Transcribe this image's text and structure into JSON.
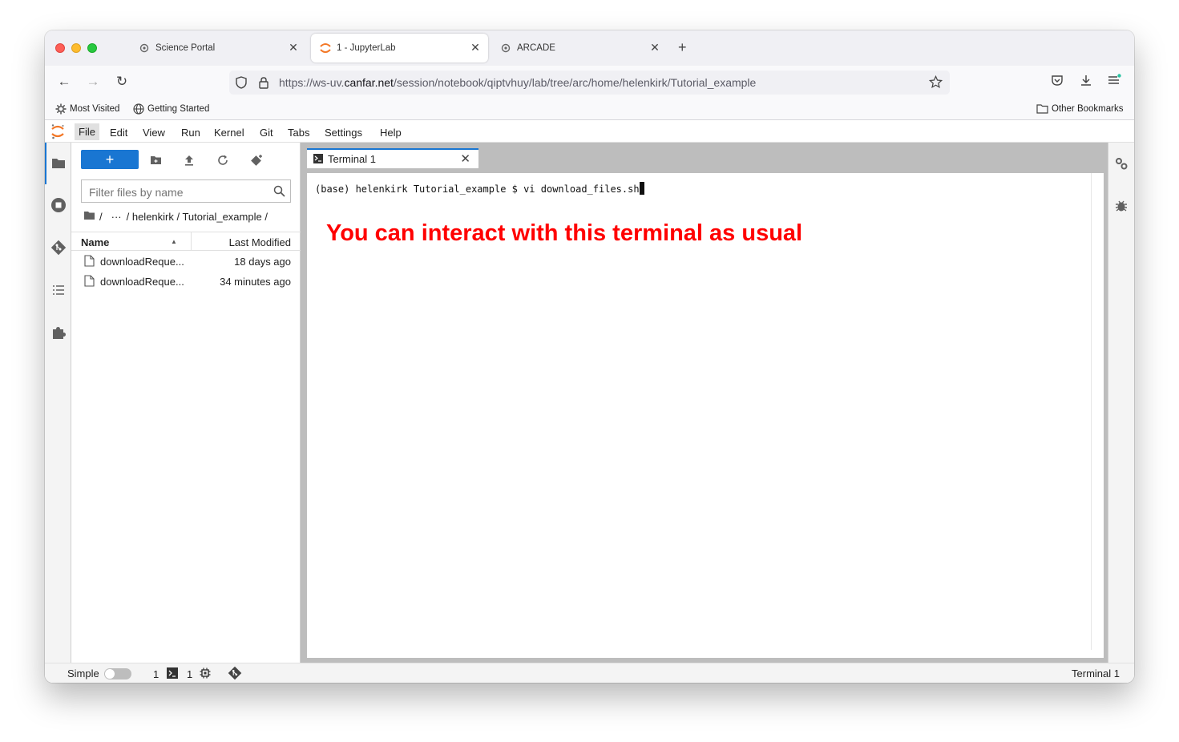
{
  "browser": {
    "tabs": [
      {
        "title": "Science Portal",
        "icon": "puzzle-gear-icon",
        "active": false
      },
      {
        "title": "1 - JupyterLab",
        "icon": "jupyter-logo-icon",
        "active": true
      },
      {
        "title": "ARCADE",
        "icon": "puzzle-gear-icon",
        "active": false
      }
    ],
    "new_tab": "+",
    "url_host_prefix": "https://ws-uv.",
    "url_host_domain": "canfar.net",
    "url_path": "/session/notebook/qiptvhuy/lab/tree/arc/home/helenkirk/Tutorial_example",
    "bookmarks": [
      {
        "label": "Most Visited",
        "icon": "gear-icon"
      },
      {
        "label": "Getting Started",
        "icon": "globe-icon"
      }
    ],
    "other_bookmarks": "Other Bookmarks"
  },
  "jupyter": {
    "menus": [
      "File",
      "Edit",
      "View",
      "Run",
      "Kernel",
      "Git",
      "Tabs",
      "Settings",
      "Help"
    ],
    "new_button": "+",
    "filter_placeholder": "Filter files by name",
    "breadcrumb": {
      "root": "/",
      "ellipsis": "···",
      "path": "/ helenkirk / Tutorial_example /"
    },
    "columns": {
      "name": "Name",
      "modified": "Last Modified"
    },
    "files": [
      {
        "name": "downloadReque...",
        "modified": "18 days ago"
      },
      {
        "name": "downloadReque...",
        "modified": "34 minutes ago"
      }
    ],
    "terminal_tab": "Terminal 1",
    "terminal_prompt": "(base) helenkirk Tutorial_example $ vi download_files.sh",
    "annotation": "You can interact with this terminal as usual",
    "status": {
      "mode_label": "Simple",
      "terminals_count": "1",
      "kernels_count": "1",
      "current": "Terminal 1"
    }
  },
  "colors": {
    "accent": "#1976d2",
    "annotation": "#ff0000",
    "jupyter_orange": "#f37726"
  }
}
